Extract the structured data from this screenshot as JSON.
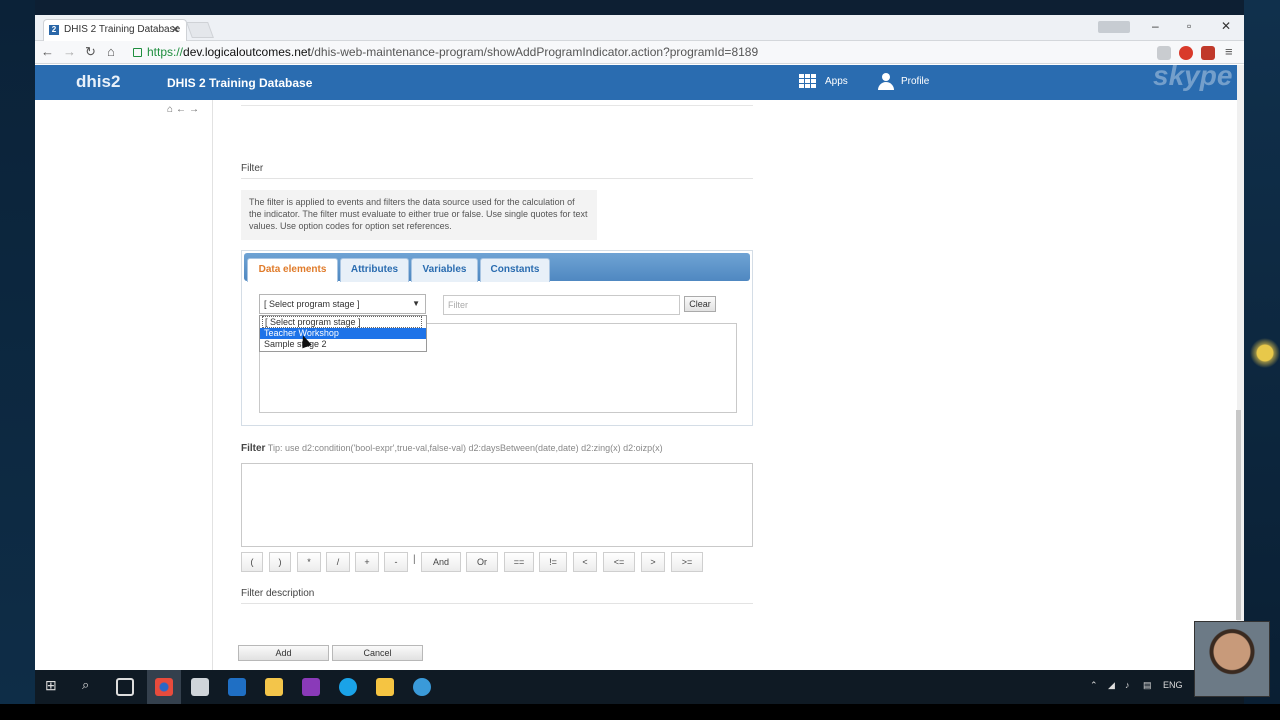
{
  "browser": {
    "tab_title": "DHIS 2 Training Database",
    "tab_favicon": "2",
    "url_scheme": "https://",
    "url_host": "dev.logicaloutcomes.net",
    "url_path": "/dhis-web-maintenance-program/showAddProgramIndicator.action?programId=8189"
  },
  "header": {
    "logo": "dhis2",
    "title": "DHIS 2 Training Database",
    "apps_label": "Apps",
    "profile_label": "Profile",
    "watermark": "skype"
  },
  "filter_section": {
    "title": "Filter",
    "help_text": "The filter is applied to events and filters the data source used for the calculation of the indicator. The filter must evaluate to either true or false. Use single quotes for text values. Use option codes for option set references."
  },
  "tabs": [
    {
      "label": "Data elements",
      "active": true
    },
    {
      "label": "Attributes",
      "active": false
    },
    {
      "label": "Variables",
      "active": false
    },
    {
      "label": "Constants",
      "active": false
    }
  ],
  "stage_select": {
    "value": "[ Select program stage ]",
    "options": [
      "[ Select program stage ]",
      "Teacher Workshop",
      "Sample stage 2"
    ],
    "highlighted": "Teacher Workshop"
  },
  "search": {
    "placeholder": "Filter",
    "clear_label": "Clear"
  },
  "expression": {
    "label": "Filter",
    "tip": "Tip: use d2:condition('bool-expr',true-val,false-val) d2:daysBetween(date,date) d2:zing(x) d2:oizp(x)",
    "operators": [
      "(",
      ")",
      "*",
      "/",
      "+",
      "-",
      "And",
      "Or",
      "==",
      "!=",
      "<",
      "<=",
      ">",
      ">="
    ],
    "separator": "|"
  },
  "description_title": "Filter description",
  "actions": {
    "add_label": "Add",
    "cancel_label": "Cancel"
  },
  "taskbar": {
    "lang": "ENG"
  },
  "colors": {
    "header_blue": "#2a6cb0",
    "active_tab_text": "#e07b2a",
    "selected_option": "#1e73e8"
  }
}
